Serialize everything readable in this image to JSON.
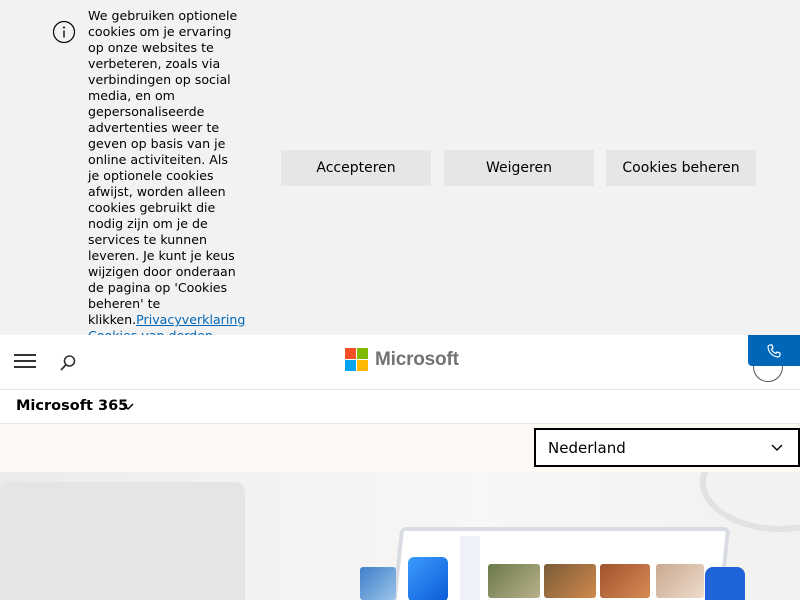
{
  "cookie_banner": {
    "message": "We gebruiken optionele cookies om je ervaring op onze websites te verbeteren, zoals via verbindingen op social media, en om gepersonaliseerde advertenties weer te geven op basis van je online activiteiten. Als je optionele cookies afwijst, worden alleen cookies gebruikt die nodig zijn om je de services te kunnen leveren. Je kunt je keus wijzigen door onderaan de pagina op 'Cookies beheren' te klikken.",
    "privacy_link": "Privacyverklaring",
    "third_party_link": "Cookies van derden",
    "accept_label": "Accepteren",
    "reject_label": "Weigeren",
    "manage_label": "Cookies beheren",
    "info_icon": "info-icon"
  },
  "header": {
    "logo_text": "Microsoft",
    "logo_colors": [
      "#f25022",
      "#7fba00",
      "#00a4ef",
      "#ffb900"
    ],
    "menu_icon": "hamburger-icon",
    "search_icon": "search-icon",
    "contact_icon": "phone-icon",
    "account_icon": "account-icon",
    "accent_color": "#0067b8"
  },
  "subnav": {
    "title": "Microsoft 365"
  },
  "region": {
    "selected": "Nederland"
  }
}
